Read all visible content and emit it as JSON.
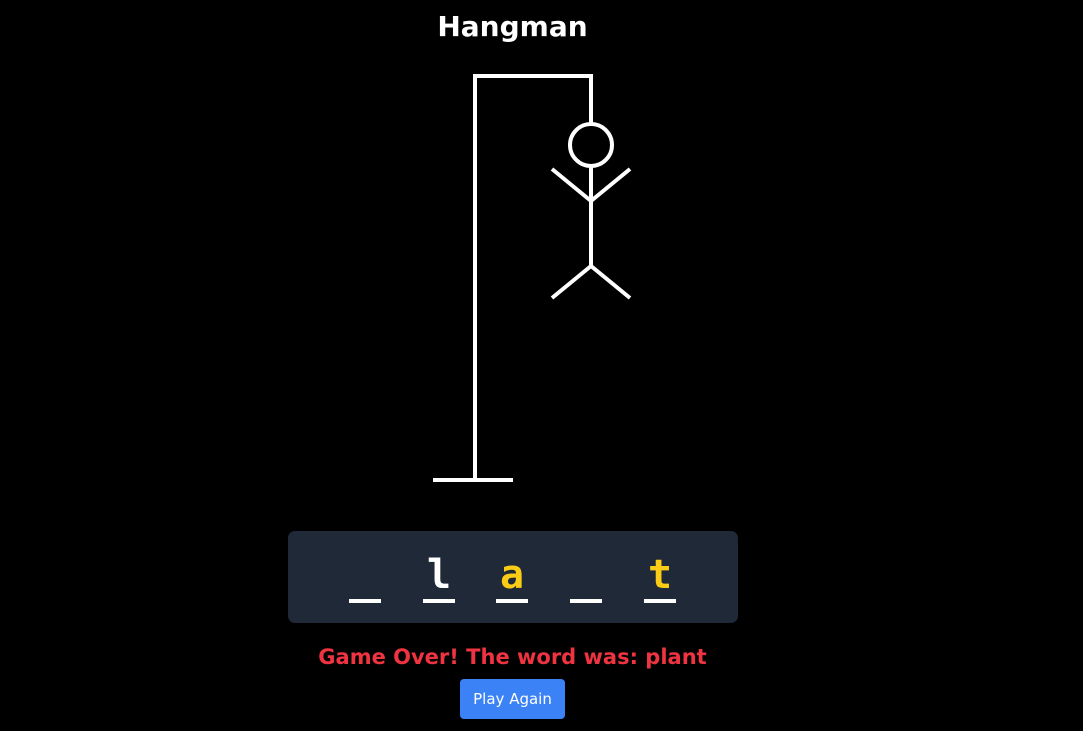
{
  "game": {
    "title": "Hangman",
    "word_slots": [
      {
        "letter": "",
        "revealed": false,
        "color": "#ffffff"
      },
      {
        "letter": "l",
        "revealed": true,
        "color": "#ffffff"
      },
      {
        "letter": "a",
        "revealed": true,
        "color": "#facc15"
      },
      {
        "letter": "",
        "revealed": false,
        "color": "#ffffff"
      },
      {
        "letter": "t",
        "revealed": true,
        "color": "#facc15"
      }
    ],
    "status_message": "Game Over! The word was: plant",
    "play_again_label": "Play Again",
    "hangman_parts_shown": [
      "head",
      "body",
      "left-arm",
      "right-arm",
      "left-leg",
      "right-leg"
    ]
  },
  "colors": {
    "background": "#000000",
    "panel": "#1f2937",
    "stroke": "#ffffff",
    "highlight_letter": "#facc15",
    "message": "#ef3340",
    "button": "#3b82f6"
  }
}
